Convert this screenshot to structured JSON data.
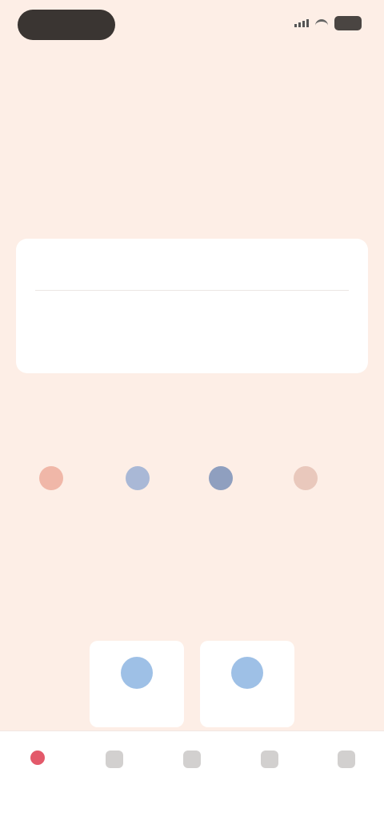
{
  "status_bar": {
    "time": ""
  },
  "hero": {
    "title": "",
    "description": "",
    "link_text": ""
  },
  "card": {
    "title": "",
    "button_label": ""
  },
  "quick_section": {
    "title": "",
    "items": [
      {
        "label": "",
        "icon": "user-icon",
        "color": "#f0b7a8"
      },
      {
        "label": "",
        "icon": "user-icon",
        "color": "#a9b8d6"
      },
      {
        "label": "",
        "icon": "user-icon",
        "color": "#8f9fbf"
      },
      {
        "label": "",
        "icon": "user-icon",
        "color": "#e9c8bc"
      }
    ]
  },
  "services": {
    "title": "",
    "subtitle": "",
    "tiles": [
      {
        "label": "",
        "icon": "profile-icon"
      },
      {
        "label": "",
        "icon": "profile-icon"
      }
    ]
  },
  "tabbar": {
    "tabs": [
      {
        "label": "",
        "icon": "home-icon",
        "active": true
      },
      {
        "label": "",
        "icon": "grid-icon",
        "active": false
      },
      {
        "label": "",
        "icon": "list-icon",
        "active": false
      },
      {
        "label": "",
        "icon": "chat-icon",
        "active": false
      },
      {
        "label": "",
        "icon": "profile-icon",
        "active": false
      }
    ]
  },
  "colors": {
    "background": "#fdeee6",
    "accent": "#e25b45",
    "tab_active": "#e3596a"
  }
}
